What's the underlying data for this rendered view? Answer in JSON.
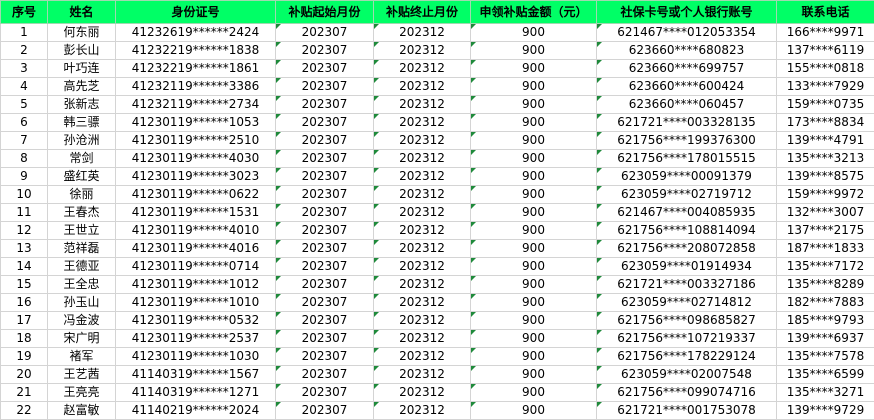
{
  "columns": [
    "序号",
    "姓名",
    "身份证号",
    "补贴起始月份",
    "补贴终止月份",
    "申领补贴金额（元）",
    "社保卡号或个人银行账号",
    "联系电话"
  ],
  "rows": [
    [
      "1",
      "何东丽",
      "41232619******2424",
      "202307",
      "202312",
      "900",
      "621467****012053354",
      "166****9971"
    ],
    [
      "2",
      "彭长山",
      "41232219******1838",
      "202307",
      "202312",
      "900",
      "623660****680823",
      "137****6119"
    ],
    [
      "3",
      "叶巧连",
      "41232219******1861",
      "202307",
      "202312",
      "900",
      "623660****699757",
      "155****0818"
    ],
    [
      "4",
      "高先芝",
      "41232119******3386",
      "202307",
      "202312",
      "900",
      "623660****600424",
      "133****7929"
    ],
    [
      "5",
      "张新志",
      "41232119******2734",
      "202307",
      "202312",
      "900",
      "623660****060457",
      "159****0735"
    ],
    [
      "6",
      "韩三骠",
      "41230119******1053",
      "202307",
      "202312",
      "900",
      "621721****003328135",
      "173****8834"
    ],
    [
      "7",
      "孙沧洲",
      "41230119******2510",
      "202307",
      "202312",
      "900",
      "621756****199376300",
      "139****4791"
    ],
    [
      "8",
      "常剑",
      "41230119******4030",
      "202307",
      "202312",
      "900",
      "621756****178015515",
      "135****3213"
    ],
    [
      "9",
      "盛红英",
      "41230119******3023",
      "202307",
      "202312",
      "900",
      "623059****00091379",
      "139****8575"
    ],
    [
      "10",
      "徐丽",
      "41230119******0622",
      "202307",
      "202312",
      "900",
      "623059****02719712",
      "159****9972"
    ],
    [
      "11",
      "王春杰",
      "41230119******1531",
      "202307",
      "202312",
      "900",
      "621467****004085935",
      "132****3007"
    ],
    [
      "12",
      "王世立",
      "41230119******4010",
      "202307",
      "202312",
      "900",
      "621756****108814094",
      "137****2175"
    ],
    [
      "13",
      "范祥磊",
      "41230119******4016",
      "202307",
      "202312",
      "900",
      "621756****208072858",
      "187****1833"
    ],
    [
      "14",
      "王德亚",
      "41230119******0714",
      "202307",
      "202312",
      "900",
      "623059****01914934",
      "135****7172"
    ],
    [
      "15",
      "王全忠",
      "41230119******1012",
      "202307",
      "202312",
      "900",
      "621721****003327186",
      "135****8289"
    ],
    [
      "16",
      "孙玉山",
      "41230119******1010",
      "202307",
      "202312",
      "900",
      "623059****02714812",
      "182****7883"
    ],
    [
      "17",
      "冯金波",
      "41230119******0532",
      "202307",
      "202312",
      "900",
      "621756****098685827",
      "185****9793"
    ],
    [
      "18",
      "宋广明",
      "41230119******2537",
      "202307",
      "202312",
      "900",
      "621756****107219337",
      "139****6937"
    ],
    [
      "19",
      "褚军",
      "41230119******1030",
      "202307",
      "202312",
      "900",
      "621756****178229124",
      "135****7578"
    ],
    [
      "20",
      "王艺茜",
      "41140319******1567",
      "202307",
      "202312",
      "900",
      "623059****02007548",
      "135****6599"
    ],
    [
      "21",
      "王亮亮",
      "41140319******1271",
      "202307",
      "202312",
      "900",
      "621756****099074716",
      "135****3271"
    ],
    [
      "22",
      "赵富敏",
      "41140219******2024",
      "202307",
      "202312",
      "900",
      "621721****001753078",
      "139****9729"
    ]
  ]
}
